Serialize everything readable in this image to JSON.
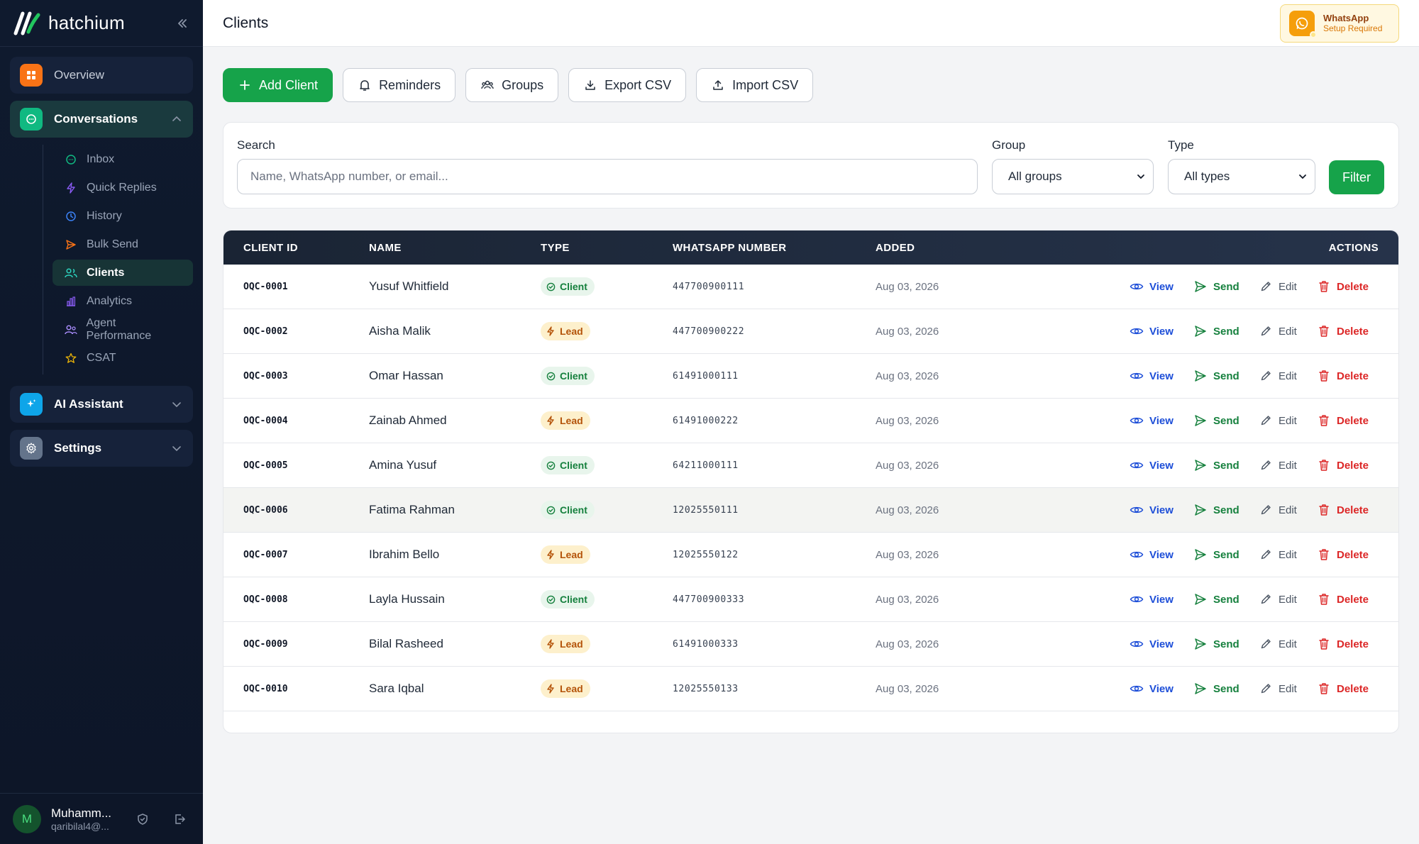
{
  "brand": {
    "name": "hatchium"
  },
  "sidebar": {
    "overview": "Overview",
    "conversations": "Conversations",
    "sub_items": [
      {
        "label": "Inbox",
        "icon": "inbox-icon"
      },
      {
        "label": "Quick Replies",
        "icon": "bolt-icon"
      },
      {
        "label": "History",
        "icon": "clock-icon"
      },
      {
        "label": "Bulk Send",
        "icon": "send-icon"
      },
      {
        "label": "Clients",
        "icon": "users-icon"
      },
      {
        "label": "Analytics",
        "icon": "bar-chart-icon"
      },
      {
        "label": "Agent Performance",
        "icon": "agents-icon"
      },
      {
        "label": "CSAT",
        "icon": "star-icon"
      }
    ],
    "ai_assistant": "AI Assistant",
    "settings": "Settings"
  },
  "user": {
    "initial": "M",
    "name": "Muhamm...",
    "email": "qaribilal4@..."
  },
  "header": {
    "title": "Clients",
    "whatsapp_title": "WhatsApp",
    "whatsapp_sub": "Setup Required"
  },
  "toolbar": {
    "add_client": "Add Client",
    "reminders": "Reminders",
    "groups": "Groups",
    "export_csv": "Export CSV",
    "import_csv": "Import CSV"
  },
  "filters": {
    "search_label": "Search",
    "search_placeholder": "Name, WhatsApp number, or email...",
    "group_label": "Group",
    "group_value": "All groups",
    "type_label": "Type",
    "type_value": "All types",
    "filter_button": "Filter"
  },
  "table": {
    "headers": {
      "client_id": "CLIENT ID",
      "name": "NAME",
      "type": "TYPE",
      "whatsapp": "WHATSAPP NUMBER",
      "added": "ADDED",
      "actions": "ACTIONS"
    },
    "action_labels": {
      "view": "View",
      "send": "Send",
      "edit": "Edit",
      "delete": "Delete"
    },
    "rows": [
      {
        "id": "OQC-0001",
        "name": "Yusuf Whitfield",
        "type": "Client",
        "whatsapp": "447700900111",
        "added": "Aug 03, 2026"
      },
      {
        "id": "OQC-0002",
        "name": "Aisha Malik",
        "type": "Lead",
        "whatsapp": "447700900222",
        "added": "Aug 03, 2026"
      },
      {
        "id": "OQC-0003",
        "name": "Omar Hassan",
        "type": "Client",
        "whatsapp": "61491000111",
        "added": "Aug 03, 2026"
      },
      {
        "id": "OQC-0004",
        "name": "Zainab Ahmed",
        "type": "Lead",
        "whatsapp": "61491000222",
        "added": "Aug 03, 2026"
      },
      {
        "id": "OQC-0005",
        "name": "Amina Yusuf",
        "type": "Client",
        "whatsapp": "64211000111",
        "added": "Aug 03, 2026"
      },
      {
        "id": "OQC-0006",
        "name": "Fatima Rahman",
        "type": "Client",
        "whatsapp": "12025550111",
        "added": "Aug 03, 2026"
      },
      {
        "id": "OQC-0007",
        "name": "Ibrahim Bello",
        "type": "Lead",
        "whatsapp": "12025550122",
        "added": "Aug 03, 2026"
      },
      {
        "id": "OQC-0008",
        "name": "Layla Hussain",
        "type": "Client",
        "whatsapp": "447700900333",
        "added": "Aug 03, 2026"
      },
      {
        "id": "OQC-0009",
        "name": "Bilal Rasheed",
        "type": "Lead",
        "whatsapp": "61491000333",
        "added": "Aug 03, 2026"
      },
      {
        "id": "OQC-0010",
        "name": "Sara Iqbal",
        "type": "Lead",
        "whatsapp": "12025550133",
        "added": "Aug 03, 2026"
      }
    ]
  },
  "colors": {
    "accent": "#16a34a",
    "sidebar_bg": "#0f1a2e",
    "danger": "#dc2626",
    "link": "#1d4ed8"
  }
}
